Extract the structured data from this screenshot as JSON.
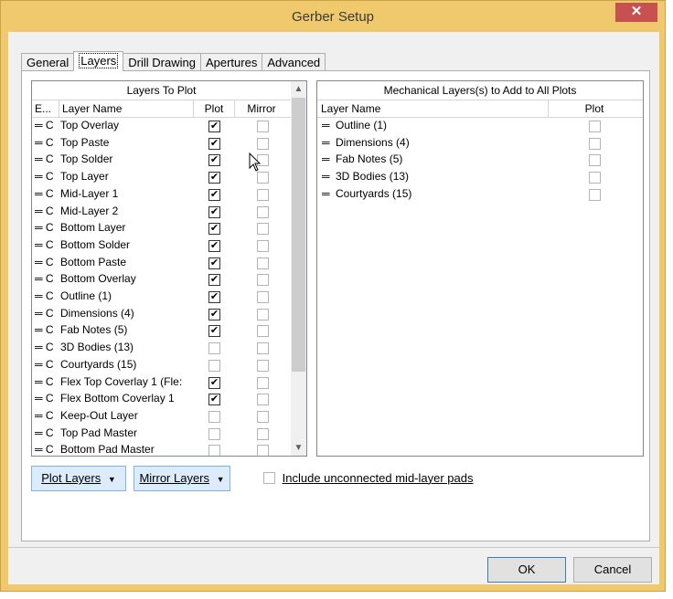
{
  "window": {
    "title": "Gerber Setup",
    "close_glyph": "✕"
  },
  "tabs": [
    {
      "label": "General"
    },
    {
      "label": "Layers"
    },
    {
      "label": "Drill Drawing"
    },
    {
      "label": "Apertures"
    },
    {
      "label": "Advanced"
    }
  ],
  "layers_panel": {
    "header": "Layers To Plot",
    "col_e": "E...",
    "col_name": "Layer Name",
    "col_plot": "Plot",
    "col_mirror": "Mirror",
    "rows": [
      {
        "prefix": "═ C",
        "name": "Top Overlay",
        "plot": true
      },
      {
        "prefix": "═ C",
        "name": "Top Paste",
        "plot": true
      },
      {
        "prefix": "═ C",
        "name": "Top Solder",
        "plot": true
      },
      {
        "prefix": "═ C",
        "name": "Top Layer",
        "plot": true
      },
      {
        "prefix": "═ C",
        "name": "Mid-Layer 1",
        "plot": true
      },
      {
        "prefix": "═ C",
        "name": "Mid-Layer 2",
        "plot": true
      },
      {
        "prefix": "═ C",
        "name": "Bottom Layer",
        "plot": true
      },
      {
        "prefix": "═ C",
        "name": "Bottom Solder",
        "plot": true
      },
      {
        "prefix": "═ C",
        "name": "Bottom Paste",
        "plot": true
      },
      {
        "prefix": "═ C",
        "name": "Bottom Overlay",
        "plot": true
      },
      {
        "prefix": "═ C",
        "name": "Outline (1)",
        "plot": true
      },
      {
        "prefix": "═ C",
        "name": "Dimensions (4)",
        "plot": true
      },
      {
        "prefix": "═ C",
        "name": "Fab Notes (5)",
        "plot": true
      },
      {
        "prefix": "═ C",
        "name": "3D Bodies (13)",
        "plot": false
      },
      {
        "prefix": "═ C",
        "name": "Courtyards (15)",
        "plot": false
      },
      {
        "prefix": "═ C",
        "name": "Flex Top Coverlay 1 (Fle:",
        "plot": true
      },
      {
        "prefix": "═ C",
        "name": "Flex Bottom Coverlay 1",
        "plot": true
      },
      {
        "prefix": "═ C",
        "name": "Keep-Out Layer",
        "plot": false
      },
      {
        "prefix": "═ C",
        "name": "Top Pad Master",
        "plot": false
      },
      {
        "prefix": "═ C",
        "name": "Bottom Pad Master",
        "plot": false
      }
    ]
  },
  "mech_panel": {
    "header": "Mechanical Layers(s) to Add to All Plots",
    "col_name": "Layer Name",
    "col_plot": "Plot",
    "rows": [
      {
        "prefix": "═",
        "name": "Outline (1)"
      },
      {
        "prefix": "═",
        "name": "Dimensions (4)"
      },
      {
        "prefix": "═",
        "name": "Fab Notes (5)"
      },
      {
        "prefix": "═",
        "name": "3D Bodies (13)"
      },
      {
        "prefix": "═",
        "name": "Courtyards (15)"
      }
    ]
  },
  "buttons": {
    "plot_layers": "Plot Layers",
    "mirror_layers": "Mirror Layers",
    "dropdown_glyph": "▼",
    "include_unconnected": "Include unconnected mid-layer pads",
    "ok": "OK",
    "cancel": "Cancel"
  },
  "check_glyph": "✔"
}
